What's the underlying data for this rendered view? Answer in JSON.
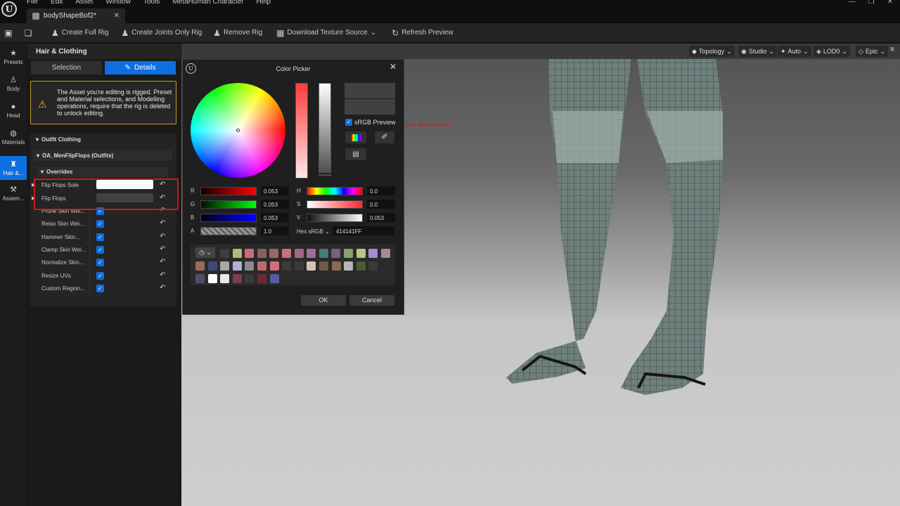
{
  "menu": [
    "File",
    "Edit",
    "Asset",
    "Window",
    "Tools",
    "MetaHuman Character",
    "Help"
  ],
  "window_controls": [
    "—",
    "❐",
    "✕"
  ],
  "doc_tab": {
    "title": "bodyShapeBof2*",
    "close": "✕"
  },
  "toolbar": {
    "create_full_rig": "Create Full Rig",
    "create_joints_only_rig": "Create Joints Only Rig",
    "remove_rig": "Remove Rig",
    "download_texture_source": "Download Texture Source",
    "refresh_preview": "Refresh Preview"
  },
  "nav": [
    {
      "label": "Presets",
      "icon": "★"
    },
    {
      "label": "Body",
      "icon": "♙"
    },
    {
      "label": "Head",
      "icon": "●"
    },
    {
      "label": "Materials",
      "icon": "◍"
    },
    {
      "label": "Hair &...",
      "icon": "♜"
    },
    {
      "label": "Assem...",
      "icon": "⚒"
    }
  ],
  "panel": {
    "title": "Hair & Clothing",
    "tab_selection": "Selection",
    "tab_details": "Details",
    "warning": "The Asset you're editing is rigged. Preset and Material selections, and Modelling operations, require that the rig is deleted to unlock editing.",
    "section_outfit": "Outfit Clothing",
    "subsection": "OA_MenFlipFlops (Outfits)",
    "overrides": "Overrides",
    "color_rows": [
      {
        "label": "Flip Flops Sole",
        "color": "#ffffff"
      },
      {
        "label": "Flip Flops",
        "color": "#414141"
      }
    ],
    "check_rows": [
      {
        "label": "Prune Skin Wei...",
        "checked": true
      },
      {
        "label": "Relax Skin Wei...",
        "checked": true
      },
      {
        "label": "Hammer Skin...",
        "checked": true
      },
      {
        "label": "Clamp Skin Wei...",
        "checked": true
      },
      {
        "label": "Normalize Skin...",
        "checked": true
      },
      {
        "label": "Resize UVs",
        "checked": true
      },
      {
        "label": "Custom Region...",
        "checked": true
      }
    ]
  },
  "viewport": {
    "buttons": [
      "Topology",
      "Studio",
      "Auto",
      "LOD0",
      "Epic"
    ],
    "perf_text": "poor performance."
  },
  "color_picker": {
    "title": "Color Picker",
    "current_color": "#414141",
    "srgb_preview": "sRGB Preview",
    "rgb": [
      {
        "label": "R",
        "value": "0.053"
      },
      {
        "label": "G",
        "value": "0.053"
      },
      {
        "label": "B",
        "value": "0.053"
      },
      {
        "label": "A",
        "value": "1.0"
      }
    ],
    "hsv": [
      {
        "label": "H",
        "value": "0.0"
      },
      {
        "label": "S",
        "value": "0.0"
      },
      {
        "label": "V",
        "value": "0.053"
      }
    ],
    "hex_label": "Hex sRGB",
    "hex_value": "414141FF",
    "swatches": [
      [
        "#3e3e3e",
        "#b8b57a",
        "#c86b7b",
        "#8a5f5a",
        "#a0655b",
        "#c7707e",
        "#9c6a84",
        "#a36d98",
        "#3f7e7d",
        "#775f88",
        "#8aa06e",
        "#bfbf86",
        "#a48dd3",
        "#a28aa0"
      ],
      [
        "#9a6b5a",
        "#3c4a78",
        "#a8a8a8",
        "#aeb2d6",
        "#8a8a8a",
        "#c06a6a",
        "#d36f7b",
        "#3a3a3a",
        "#3a3a3a",
        "#dcc0b8",
        "#715a4a",
        "#8a6a4e",
        "#b6b6b6",
        "#4a5a3a",
        "#3a3a3a"
      ],
      [
        "#4e5068",
        "#ffffff",
        "#e8e8e8",
        "#7a3e5a",
        "#3a3a3a",
        "#6e2a3a",
        "#5a5aa0"
      ]
    ],
    "ok": "OK",
    "cancel": "Cancel"
  }
}
